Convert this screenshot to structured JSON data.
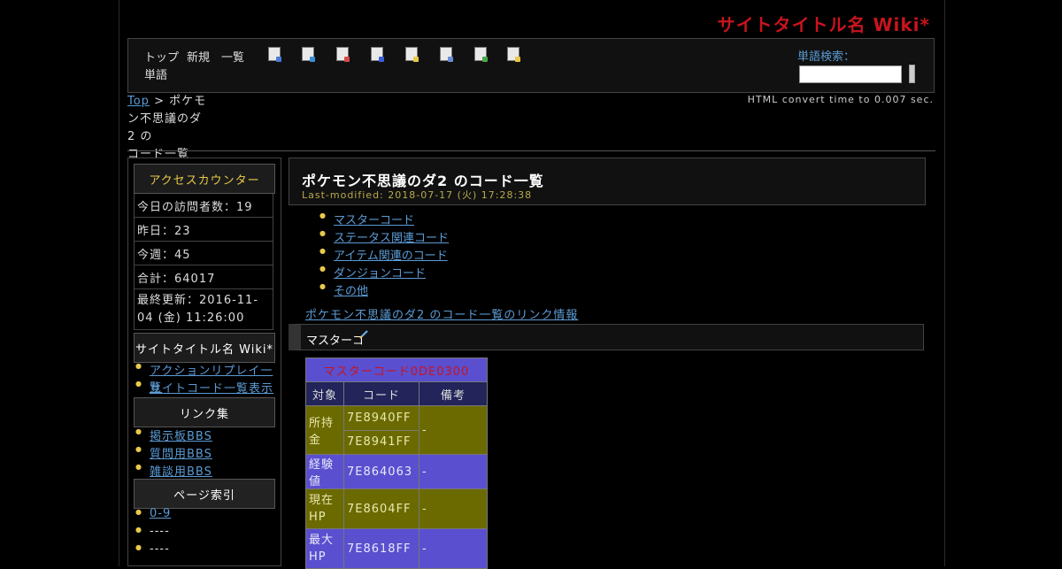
{
  "site": {
    "title": "サイトタイトル名 Wiki*"
  },
  "menu": {
    "items": [
      "トップ",
      "新規",
      "一覧",
      "単語"
    ]
  },
  "toolbar": {
    "icons": [
      "edit-page-icon",
      "diff-icon",
      "backup-icon",
      "freeze-icon",
      "rename-icon",
      "copy-icon",
      "upload-icon",
      "help-icon"
    ]
  },
  "search": {
    "label": "単語検索：",
    "value": ""
  },
  "breadcrumb": {
    "top": "Top",
    "sep": ">",
    "parent": "ポケモ",
    "line2": "ン不思議のダ2 の",
    "line3": "コード一覧"
  },
  "convert_time": "HTML convert time to 0.007 sec.",
  "sidebar": {
    "counter_title": "アクセスカウンター",
    "stats": [
      "今日の訪問者数：19",
      "昨日：23",
      "今週：45",
      "合計：64017",
      "最終更新：2016-11-04 (金) 11:26:00"
    ],
    "wiki_title": "サイトタイトル名 Wiki*",
    "wiki_links": [
      "アクションリプレイ一覧",
      "サイトコード一覧表示"
    ],
    "links_title": "リンク集",
    "link_items": [
      "掲示板BBS",
      "質問用BBS",
      "雑談用BBS"
    ],
    "index_title": "ページ索引",
    "index_items": [
      "0-9",
      "----",
      "----"
    ]
  },
  "main": {
    "title": "ポケモン不思議のダ2 のコード一覧",
    "last_modified": "Last-modified: 2018-07-17 (火) 17:28:38",
    "toc": [
      "マスターコード",
      "ステータス関連コード",
      "アイテム関連のコード",
      "ダンジョンコード",
      "その他"
    ],
    "related_link": "ポケモン不思議のダ2 のコード一覧のリンク情報",
    "section_title": "マスターコ"
  },
  "code_table": {
    "caption": "マスターコード0DE0300",
    "headers": [
      "対象",
      "コード",
      "備考"
    ],
    "rows": [
      {
        "target": "所持金",
        "codes": [
          "7E8940FF",
          "7E8941FF"
        ],
        "note": "-",
        "style": "olive"
      },
      {
        "target": "経験値",
        "codes": [
          "7E864063"
        ],
        "note": "-",
        "style": "blue"
      },
      {
        "target": "現在HP",
        "codes": [
          "7E8604FF"
        ],
        "note": "-",
        "style": "olive"
      },
      {
        "target": "最大HP",
        "codes": [
          "7E8618FF"
        ],
        "note": "-",
        "style": "blue"
      }
    ]
  },
  "colors": {
    "title_red": "#c8141e",
    "link_blue": "#5b9bd5",
    "olive": "#6b6a00",
    "table_blue": "#5a4fcf"
  }
}
